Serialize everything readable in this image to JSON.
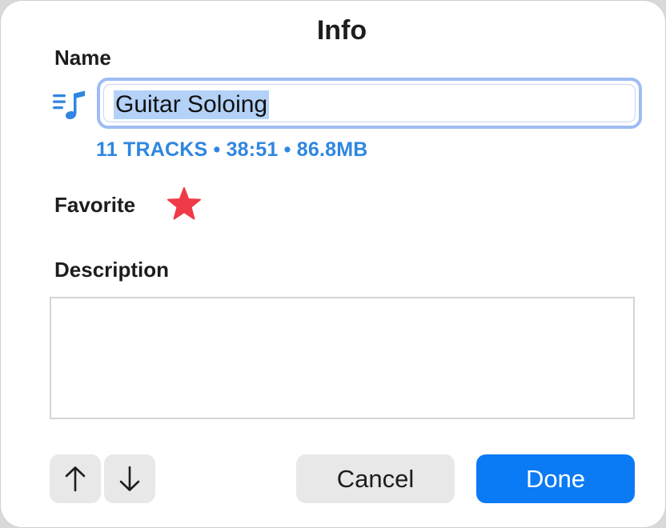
{
  "dialog": {
    "title": "Info"
  },
  "name_section": {
    "label": "Name",
    "value": "Guitar Soloing",
    "icon": "playlist-icon",
    "meta": "11 TRACKS • 38:51 • 86.8MB"
  },
  "favorite_section": {
    "label": "Favorite",
    "icon": "star-icon",
    "favorited": true
  },
  "description_section": {
    "label": "Description",
    "value": ""
  },
  "footer": {
    "previous_icon": "arrow-up-icon",
    "next_icon": "arrow-down-icon",
    "cancel_label": "Cancel",
    "done_label": "Done"
  },
  "colors": {
    "accent": "#0a7bf5",
    "meta_text": "#2f86e0",
    "star": "#f03a47",
    "selection": "#b4d2f7",
    "focus_ring": "#9ebcf3"
  }
}
